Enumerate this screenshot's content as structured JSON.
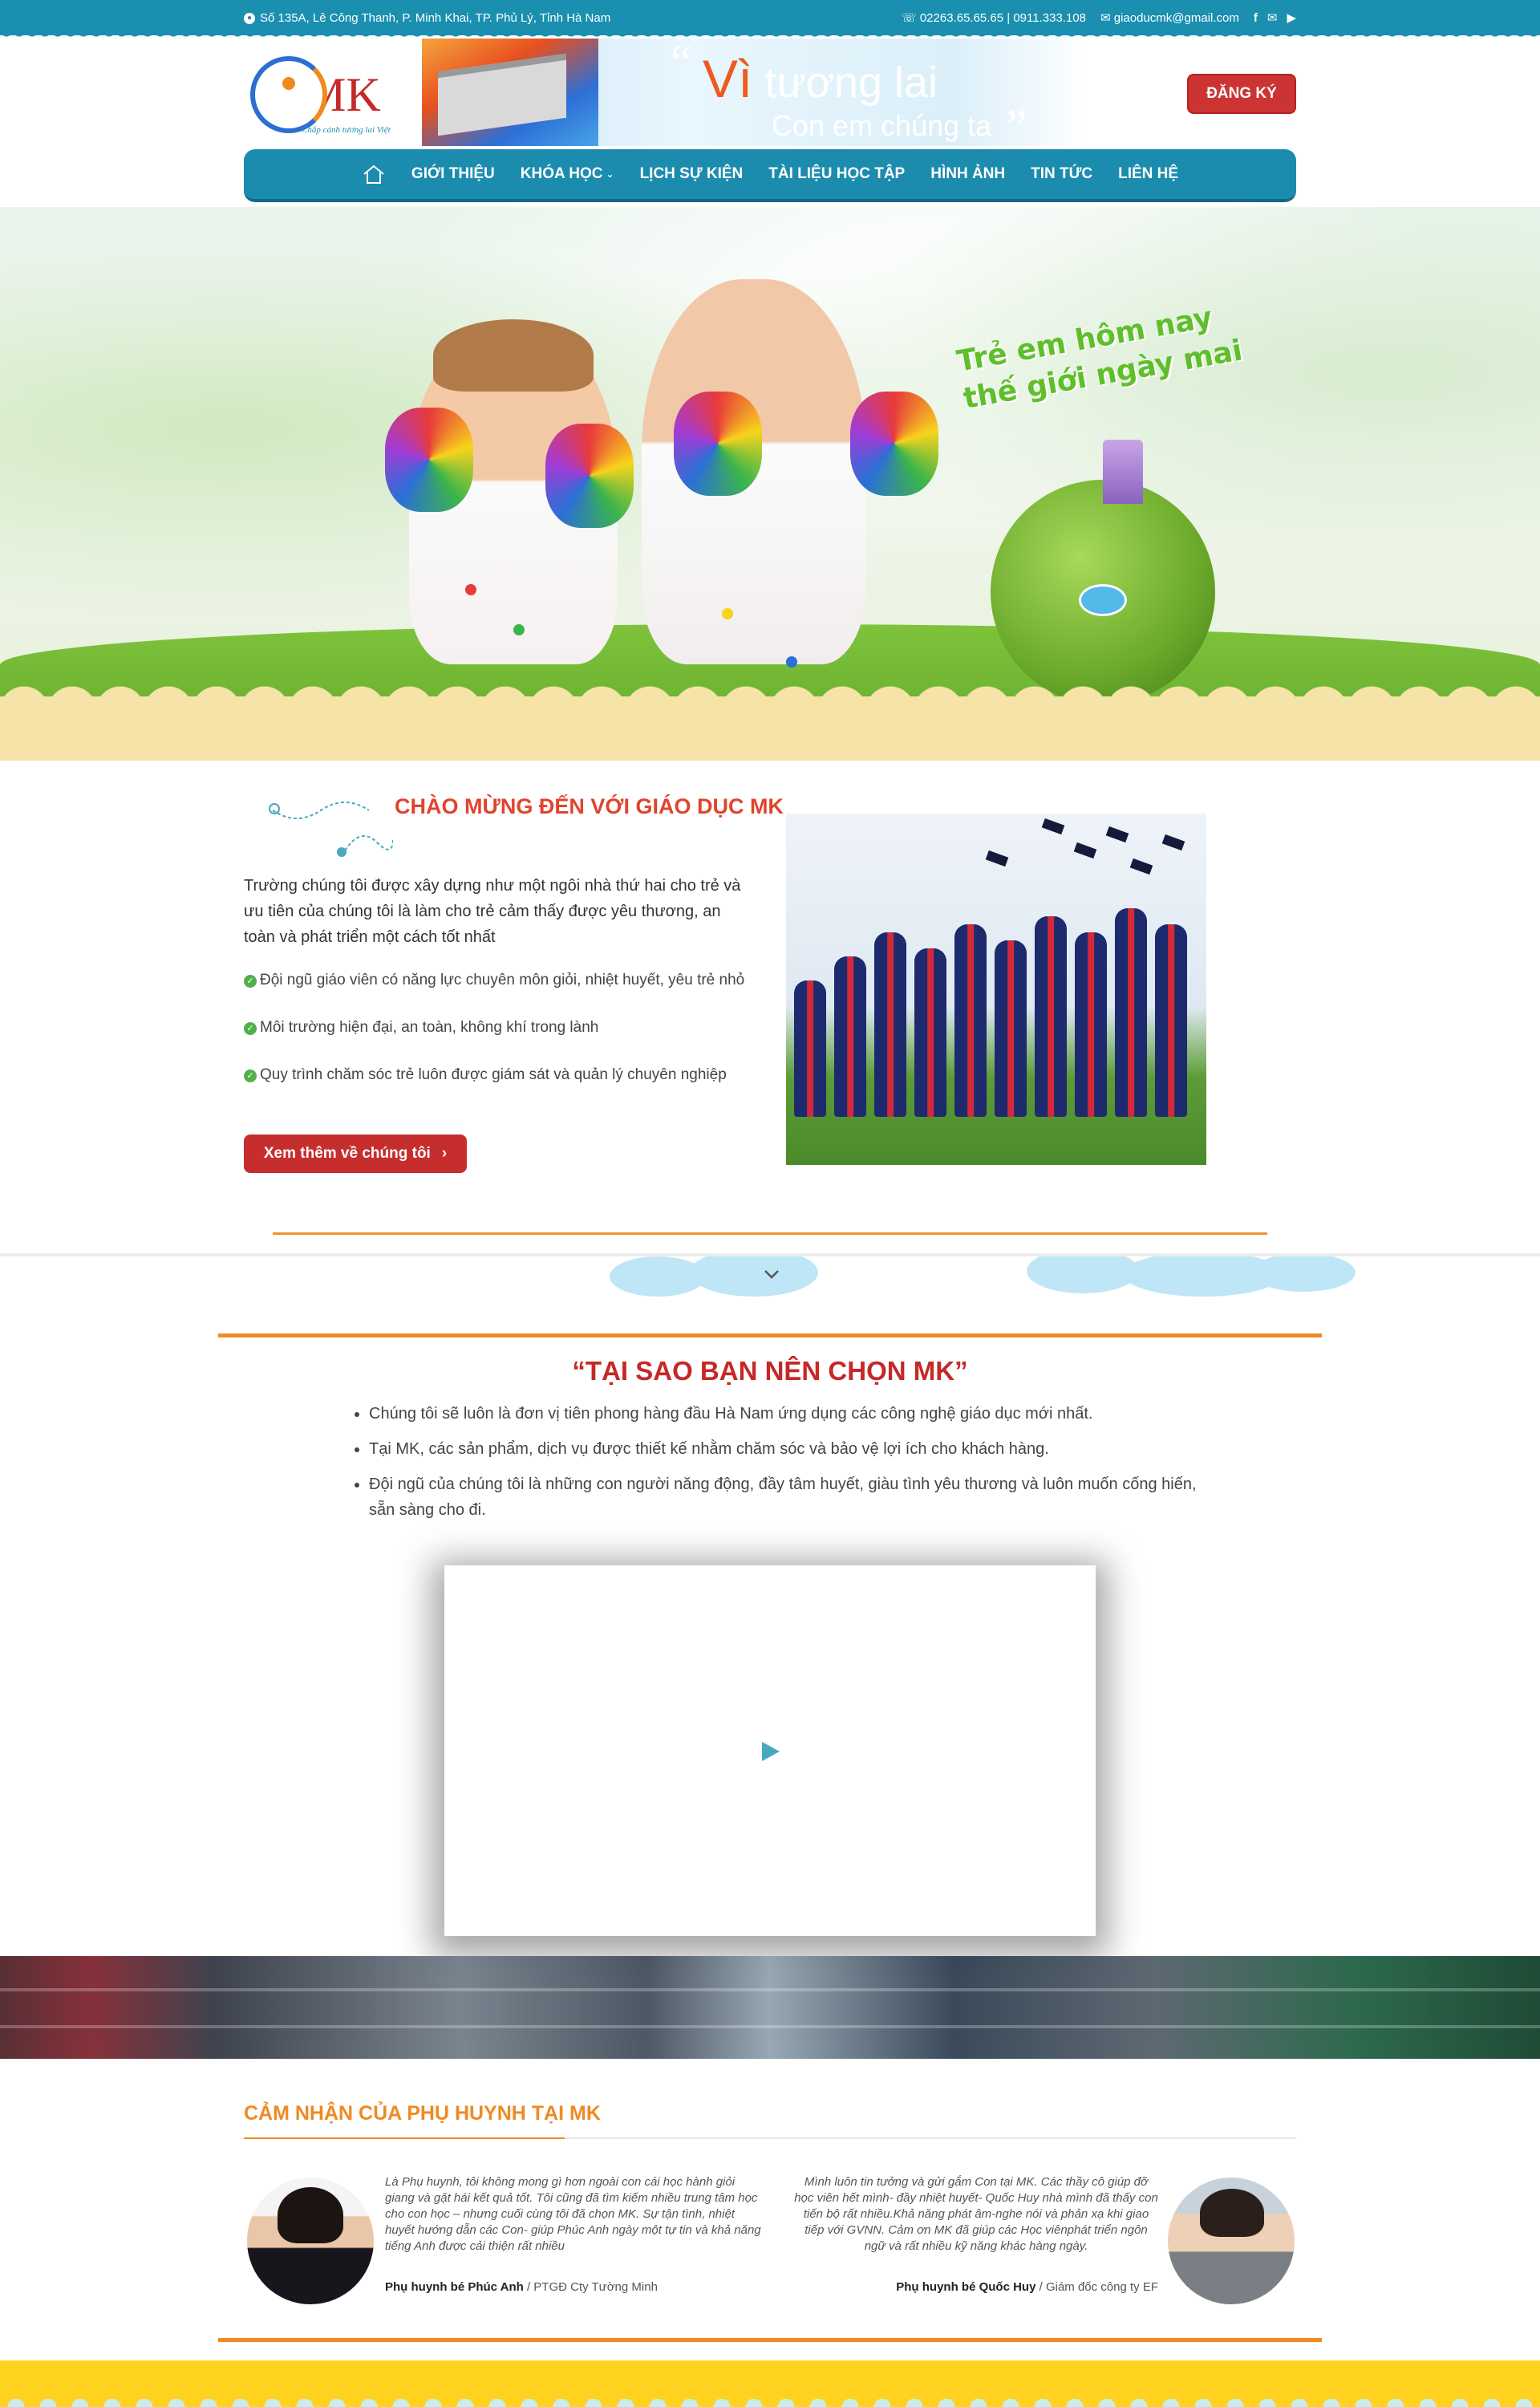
{
  "topbar": {
    "address": "Số 135A, Lê Công Thanh, P. Minh Khai, TP. Phủ Lý, Tỉnh Hà Nam",
    "phone": "02263.65.65.65 | 0911.333.108",
    "email": "giaoducmk@gmail.com",
    "social_icons": [
      "facebook-icon",
      "mail-icon",
      "youtube-icon"
    ]
  },
  "header": {
    "logo_text": "MK",
    "logo_slogan": "Chắp cánh tương lai Việt",
    "banner_line1_highlight": "Vì",
    "banner_line1": "tương lai",
    "banner_line2": "Con em chúng ta",
    "register_button": "ĐĂNG KÝ"
  },
  "nav": {
    "items": [
      {
        "label": "GIỚI THIỆU"
      },
      {
        "label": "KHÓA HỌC",
        "dropdown": true
      },
      {
        "label": "LỊCH SỰ KIỆN"
      },
      {
        "label": "TÀI LIỆU HỌC TẬP"
      },
      {
        "label": "HÌNH ẢNH"
      },
      {
        "label": "TIN TỨC"
      },
      {
        "label": "LIÊN HỆ"
      }
    ]
  },
  "hero": {
    "slogan_line1": "Trẻ em hôm nay",
    "slogan_line2": "thế giới ngày mai"
  },
  "welcome": {
    "title": "CHÀO MỪNG ĐẾN VỚI GIÁO DỤC MK",
    "intro": "Trường chúng tôi được xây dựng như một ngôi nhà thứ hai cho trẻ và ưu tiên của chúng tôi là làm cho trẻ cảm thấy được yêu thương, an toàn và phát triển một cách tốt nhất",
    "points": [
      "Đội ngũ giáo viên có năng lực chuyên môn giỏi, nhiệt huyết,  yêu trẻ nhỏ",
      "Môi trường hiện đại, an toàn, không khí trong lành",
      "Quy trình chăm sóc trẻ luôn được giám sát và quản lý chuyên nghiệp"
    ],
    "more_button": "Xem thêm về chúng tôi"
  },
  "why": {
    "title": "“TẠI SAO BẠN NÊN CHỌN MK”",
    "points": [
      "Chúng tôi sẽ luôn là đơn vị tiên phong hàng đầu Hà Nam ứng dụng các công nghệ giáo dục mới nhất.",
      "Tại MK, các sản phẩm, dịch vụ được thiết kế nhằm chăm sóc và bảo vệ lợi ích cho khách hàng.",
      "Đội ngũ của chúng tôi là những con người năng động, đầy tâm huyết, giàu tình yêu thương và luôn muốn cống hiến, sẵn sàng cho đi."
    ]
  },
  "testimonials": {
    "title": "CẢM NHẬN CỦA PHỤ HUYNH TẠI MK",
    "items": [
      {
        "quote": "Là Phụ huynh, tôi không mong gì hơn ngoài con cái học hành giỏi giang và gặt hái kết quả tốt. Tôi cũng đã tìm kiếm nhiều trung tâm học cho con học – nhưng cuối cùng tôi đã chọn MK. Sự tận tình, nhiệt huyết hướng dẫn các Con- giúp Phúc Anh ngày một tự tin và khả năng tiếng Anh được cải thiện rất nhiều",
        "name": "Phụ huynh bé Phúc Anh",
        "role": " / PTGĐ Cty Tường Minh"
      },
      {
        "quote": "Mình luôn tin tưởng và gửi gắm Con tại MK. Các thầy cô giúp đỡ học viên hết mình- đầy nhiệt huyết- Quốc Huy nhà mình đã thấy con tiến bộ rất nhiều.Khả năng phát âm-nghe nói và phản xạ khi giao tiếp với GVNN. Cảm ơn MK đã giúp các Học viênphát triển ngôn ngữ và rất nhiều kỹ năng khác hàng ngày.",
        "name": "Phụ huynh bé Quốc Huy",
        "role": " / Giám đốc công ty EF"
      }
    ]
  },
  "colors": {
    "primary": "#1a8fb0",
    "accent_red": "#c62828",
    "accent_orange": "#f08a24",
    "footer_yellow": "#ffd21f"
  }
}
